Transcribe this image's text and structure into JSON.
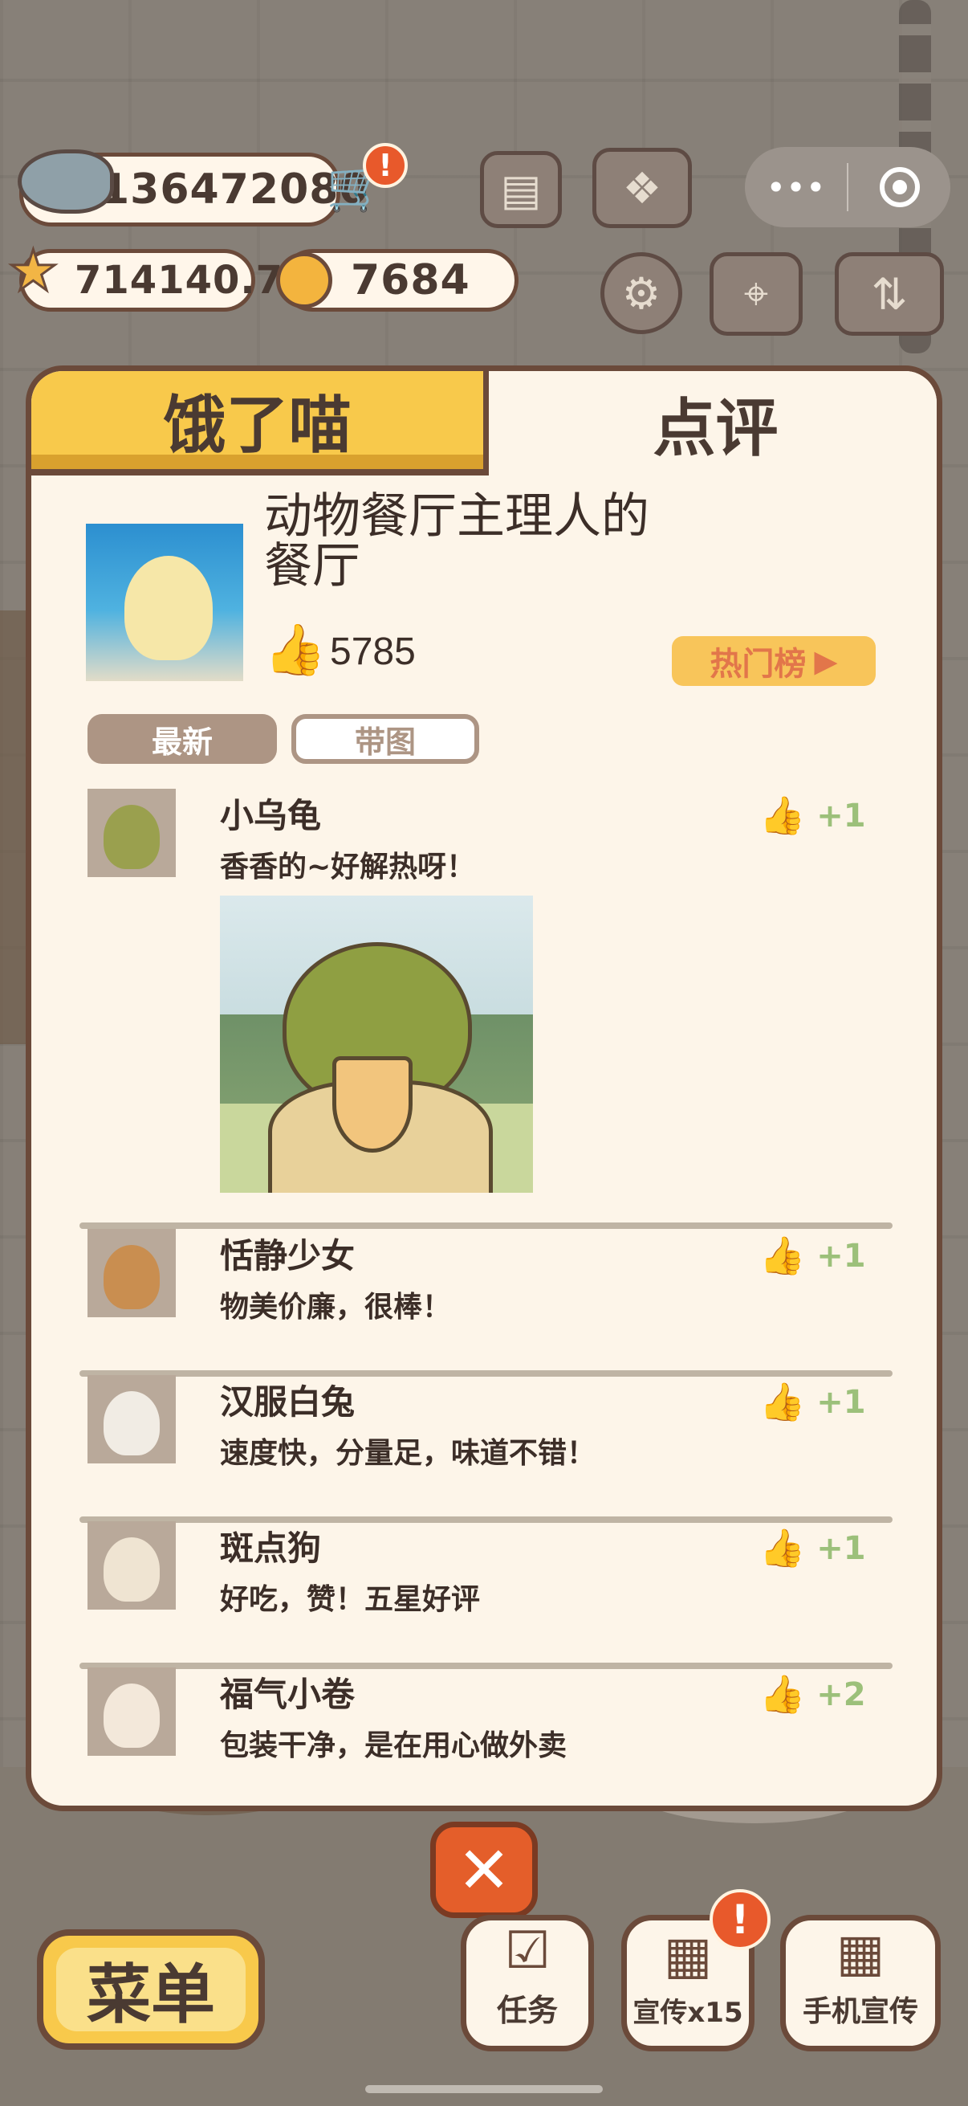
{
  "resources": {
    "fish": "136472080",
    "stars": "714140.7",
    "bells": "7684"
  },
  "alerts": {
    "cart": "!",
    "promo": "!"
  },
  "icons": {
    "fish": "fish-icon",
    "cart": "cart-icon",
    "star": "star-icon",
    "bell": "bell-icon",
    "newspaper": "newspaper-icon",
    "book": "recipe-book-icon",
    "settings": "gear-icon",
    "map": "map-icon",
    "sliders": "sliders-icon",
    "more": "more-dots-icon",
    "target": "target-icon",
    "thumb": "thumbs-up-icon",
    "close": "close-icon"
  },
  "panel": {
    "tab_hungry": "饿了喵",
    "tab_review": "点评",
    "restaurant_name": "动物餐厅主理人的餐厅",
    "likes": "5785",
    "hot_list": "热门榜",
    "filters": {
      "latest": "最新",
      "with_image": "带图"
    }
  },
  "reviews": [
    {
      "name": "小乌龟",
      "text": "香香的~好解热呀！",
      "likes": "+1",
      "has_photo": true
    },
    {
      "name": "恬静少女",
      "text": "物美价廉，很棒！",
      "likes": "+1",
      "has_photo": false
    },
    {
      "name": "汉服白兔",
      "text": "速度快，分量足，味道不错！",
      "likes": "+1",
      "has_photo": false
    },
    {
      "name": "斑点狗",
      "text": "好吃，赞！五星好评",
      "likes": "+1",
      "has_photo": false
    },
    {
      "name": "福气小卷",
      "text": "包装干净，是在用心做外卖",
      "likes": "+2",
      "has_photo": false
    }
  ],
  "bottom": {
    "menu": "菜单",
    "tasks": "任务",
    "promo": "宣传x15",
    "phone_promo": "手机宣传",
    "close": "✕"
  },
  "colors": {
    "accent_yellow": "#f8c94b",
    "border_brown": "#6b4a3a",
    "panel_bg": "#fdf5e9",
    "like_green": "#9cc07a",
    "alert_red": "#e8592b"
  }
}
